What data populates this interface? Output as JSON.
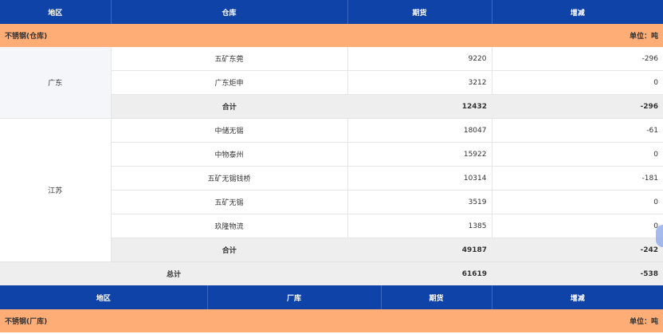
{
  "table1": {
    "headers": [
      "地区",
      "仓库",
      "期货",
      "增减"
    ],
    "band": {
      "left": "不锈钢(仓库)",
      "right": "单位：吨"
    },
    "groups": [
      {
        "region": "广东",
        "rows": [
          {
            "name": "五矿东莞",
            "futures": "9220",
            "change": "-296"
          },
          {
            "name": "广东炬申",
            "futures": "3212",
            "change": "0"
          }
        ],
        "subtotal": {
          "label": "合计",
          "futures": "12432",
          "change": "-296"
        }
      },
      {
        "region": "江苏",
        "rows": [
          {
            "name": "中储无锡",
            "futures": "18047",
            "change": "-61"
          },
          {
            "name": "中物泰州",
            "futures": "15922",
            "change": "0"
          },
          {
            "name": "五矿无锡钱桥",
            "futures": "10314",
            "change": "-181"
          },
          {
            "name": "五矿无锡",
            "futures": "3519",
            "change": "0"
          },
          {
            "name": "玖隆物流",
            "futures": "1385",
            "change": "0"
          }
        ],
        "subtotal": {
          "label": "合计",
          "futures": "49187",
          "change": "-242"
        }
      }
    ],
    "total": {
      "label": "总计",
      "futures": "61619",
      "change": "-538"
    }
  },
  "table2": {
    "headers": [
      "地区",
      "厂库",
      "期货",
      "增减"
    ],
    "band": {
      "left": "不锈钢(厂库)",
      "right": "单位：吨"
    }
  }
}
